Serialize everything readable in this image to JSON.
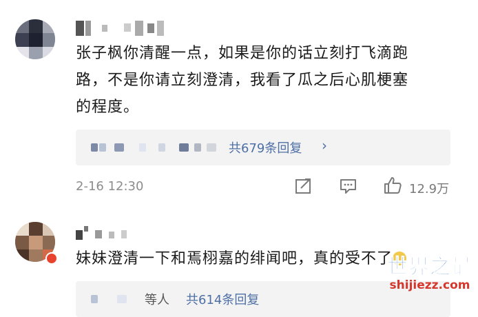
{
  "comments": [
    {
      "nickname_blurred": true,
      "text_line1": "张子枫你清醒一点，如果是你的话立刻打飞滴跑",
      "text_line2": "路，不是你请立刻澄清，我看了瓜之后心肌梗塞",
      "text_line3": "的程度。",
      "replies_label": "共679条回复",
      "timestamp": "2-16 12:30",
      "likes": "12.9万"
    },
    {
      "nickname_blurred": true,
      "text": "妹妹澄清一下和焉栩嘉的绯闻吧，真的受不了",
      "replies_label": "共614条回复",
      "replies_prefix": "等人"
    }
  ],
  "icons": {
    "share": "share-icon",
    "comment": "comment-icon",
    "like": "thumbs-up-icon",
    "chevron": "chevron-right-icon",
    "emoji": "crying-laugh-emoji-icon"
  },
  "watermark": {
    "logo": "世界之最",
    "url": "shijiezz.com"
  },
  "colors": {
    "link": "#4e6fa6",
    "meta": "#8c8c8c",
    "reply_bg": "#f3f3f3"
  }
}
